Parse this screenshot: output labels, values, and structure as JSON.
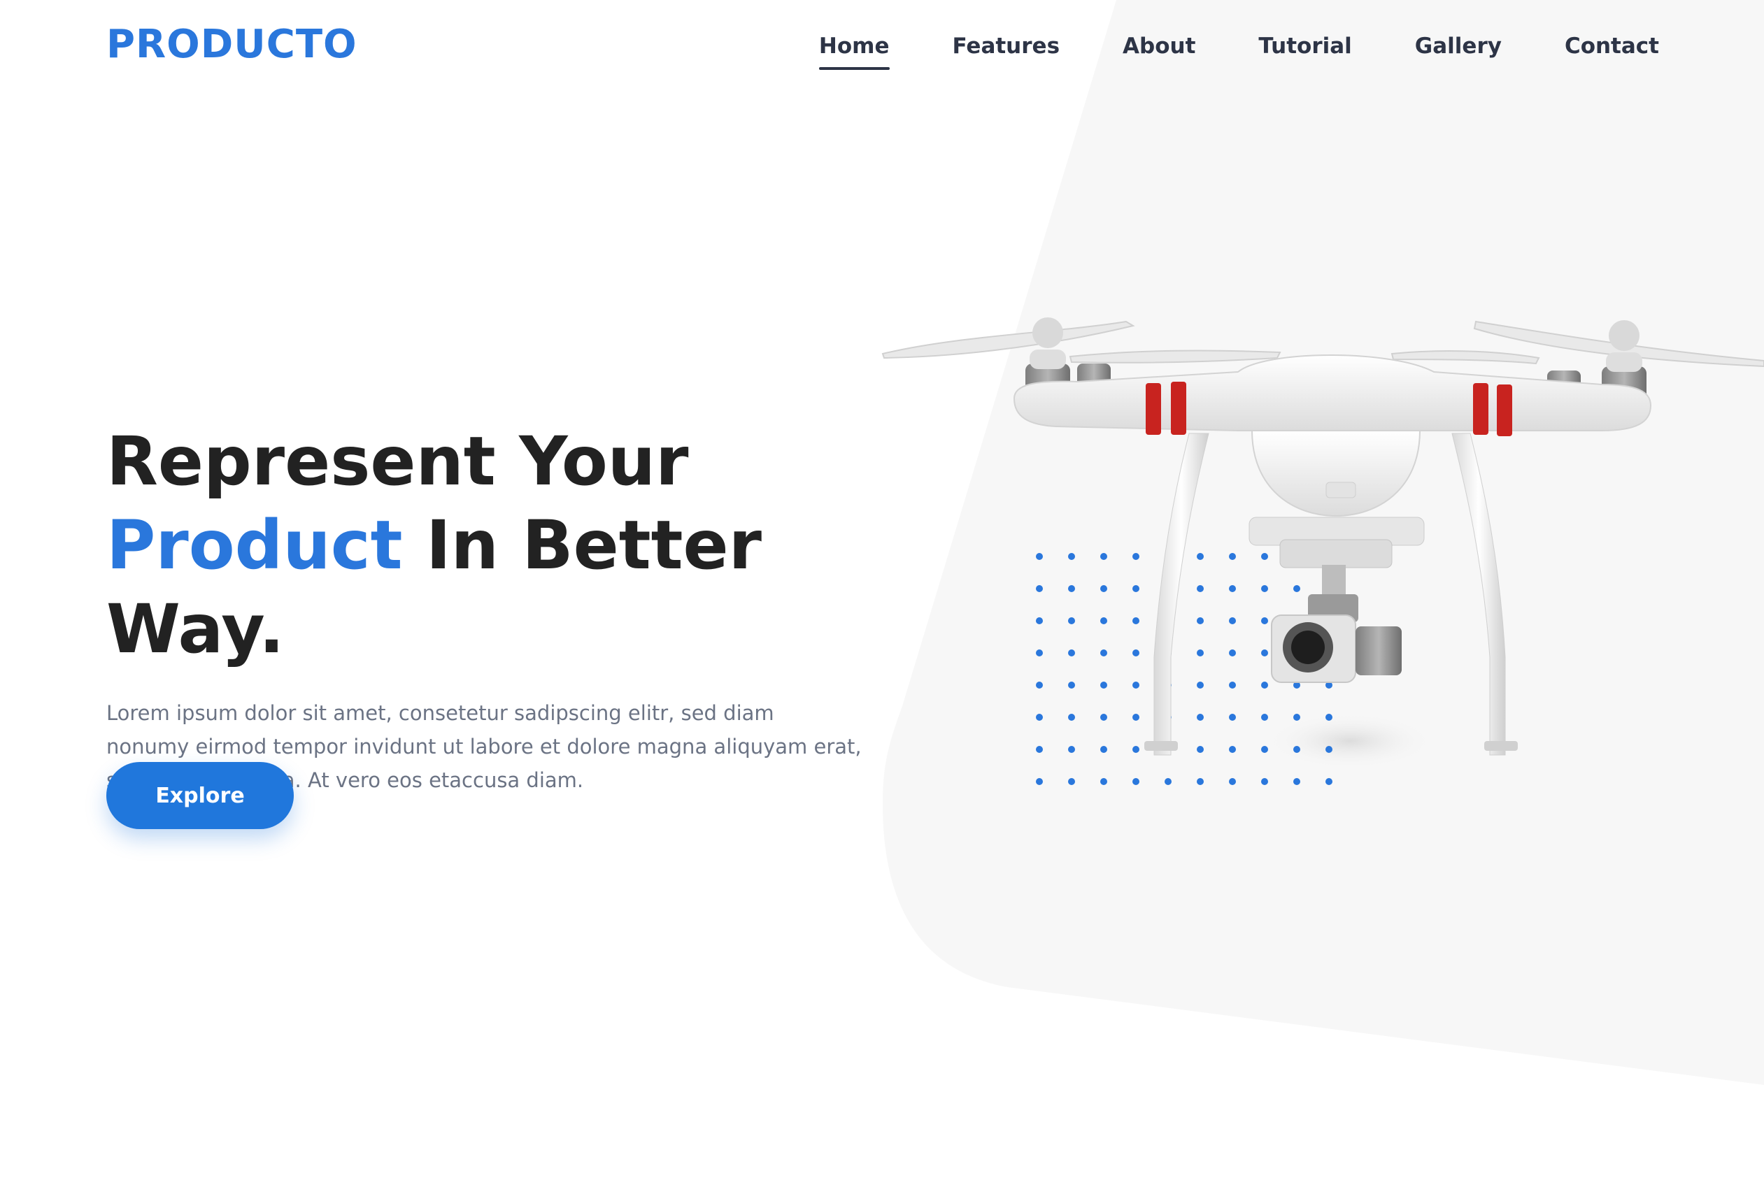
{
  "brand": {
    "logo_text": "PRODUCTO",
    "accent_color": "#2a77dc"
  },
  "nav": {
    "items": [
      {
        "label": "Home",
        "active": true
      },
      {
        "label": "Features",
        "active": false
      },
      {
        "label": "About",
        "active": false
      },
      {
        "label": "Tutorial",
        "active": false
      },
      {
        "label": "Gallery",
        "active": false
      },
      {
        "label": "Contact",
        "active": false
      }
    ]
  },
  "hero": {
    "title_line1": "Represent Your",
    "title_highlight": "Product",
    "title_line2_rest": " In Better Way.",
    "description": "Lorem ipsum dolor sit amet, consetetur sadipscing elitr, sed diam nonumy eirmod tempor invidunt ut labore et dolore magna aliquyam erat, sed diam voluptua. At vero eos etaccusa diam.",
    "button_label": "Explore"
  },
  "image": {
    "name": "drone-product-image"
  }
}
